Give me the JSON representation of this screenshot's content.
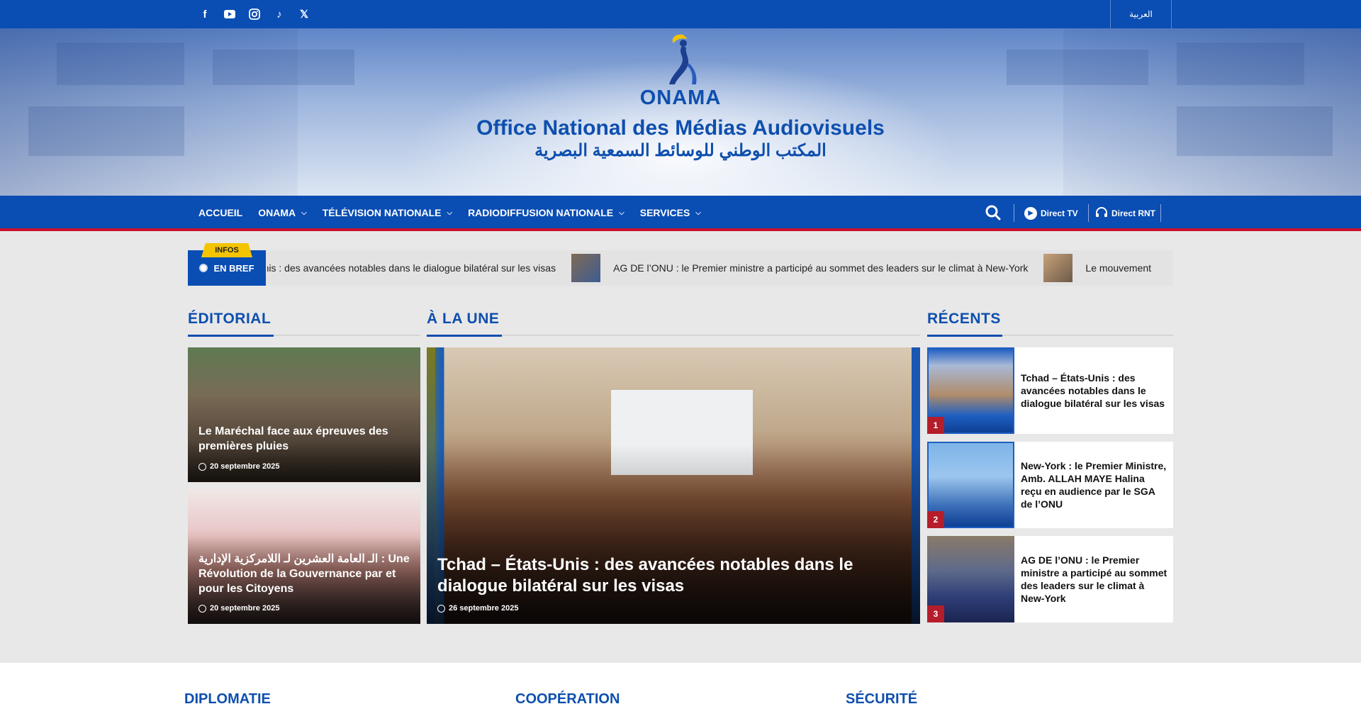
{
  "topbar": {
    "social_icons": [
      "facebook-icon",
      "youtube-icon",
      "instagram-icon",
      "tiktok-icon",
      "x-icon"
    ],
    "language_label": "العربية"
  },
  "header": {
    "brand": "ONAMA",
    "title": "Office National des Médias Audiovisuels",
    "arabic_title": "المكتب الوطني للوسائط السمعية البصرية"
  },
  "nav": {
    "items": [
      {
        "label": "ACCUEIL",
        "has_dropdown": false
      },
      {
        "label": "ONAMA",
        "has_dropdown": true
      },
      {
        "label": "TÉLÉVISION NATIONALE",
        "has_dropdown": true
      },
      {
        "label": "RADIODIFFUSION NATIONALE",
        "has_dropdown": true
      },
      {
        "label": "SERVICES",
        "has_dropdown": true
      }
    ],
    "direct_tv": "Direct TV",
    "direct_rnt": "Direct RNT"
  },
  "ticker": {
    "badge": "INFOS",
    "label": "EN BREF",
    "items": [
      "Tchad – États-Unis : des avancées notables dans le dialogue bilatéral sur les visas",
      "AG DE l’ONU : le Premier ministre a participé au sommet des leaders sur le climat à New-York",
      "Le mouvement"
    ]
  },
  "sections": {
    "editorial": "ÉDITORIAL",
    "a_la_une": "À LA UNE",
    "recents": "RÉCENTS"
  },
  "editorial": [
    {
      "title": "Le Maréchal face aux épreuves des premières pluies",
      "date": "20 septembre 2025"
    },
    {
      "title": "الـ العامة العشرين لـ اللامركزية الإدارية : Une Révolution de la Gouvernance par et pour les Citoyens",
      "date": "20 septembre 2025"
    }
  ],
  "featured": {
    "title": "Tchad – États-Unis : des avancées notables dans le dialogue bilatéral sur les visas",
    "date": "26 septembre 2025"
  },
  "recents": [
    {
      "rank": "1",
      "title": "Tchad – États-Unis : des avancées notables dans le dialogue bilatéral sur les visas"
    },
    {
      "rank": "2",
      "title": "New-York : le Premier Ministre, Amb. ALLAH MAYE Halina reçu en audience par le SGA de l’ONU"
    },
    {
      "rank": "3",
      "title": "AG DE l’ONU : le Premier ministre a participé au sommet des leaders sur le climat à New-York"
    }
  ],
  "lower_sections": [
    "DIPLOMATIE",
    "COOPÉRATION",
    "SÉCURITÉ"
  ],
  "colors": {
    "primary": "#0a4db3",
    "accent_red": "#c8102e",
    "badge_yellow": "#f4c400"
  }
}
